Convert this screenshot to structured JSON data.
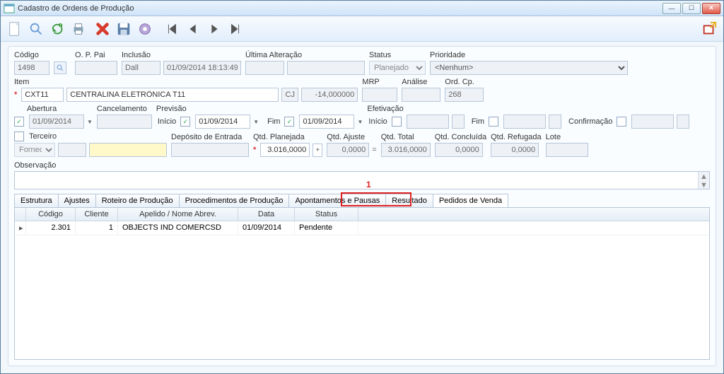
{
  "window": {
    "title": "Cadastro de Ordens de Produção"
  },
  "icons": {
    "app": "app-icon",
    "new": "new-icon",
    "search": "search-icon",
    "refresh": "refresh-icon",
    "print": "print-icon",
    "delete": "delete-icon",
    "save": "save-icon",
    "settings": "gear-icon",
    "first": "first-icon",
    "prev": "prev-icon",
    "next": "next-icon",
    "last": "last-icon",
    "export": "export-icon"
  },
  "header": {
    "codigo": {
      "label": "Código",
      "value": "1498"
    },
    "oppai": {
      "label": "O. P. Pai",
      "value": ""
    },
    "inclusao": {
      "label": "Inclusão",
      "user": "Dall",
      "datetime": "01/09/2014 18:13:49"
    },
    "ultima_alt": {
      "label": "Última Alteração",
      "user": "",
      "datetime": ""
    },
    "status": {
      "label": "Status",
      "value": "Planejado"
    },
    "prioridade": {
      "label": "Prioridade",
      "value": "<Nenhum>"
    }
  },
  "item": {
    "label": "Item",
    "code": "CXT11",
    "desc": "CENTRALINA ELETRÔNICA T11",
    "cj_btn": "CJ",
    "qty": "-14,000000",
    "mrp": {
      "label": "MRP",
      "value": ""
    },
    "analise": {
      "label": "Análise",
      "value": ""
    },
    "ordcp": {
      "label": "Ord. Cp.",
      "value": "268"
    }
  },
  "dates": {
    "abertura": {
      "label": "Abertura",
      "value": "01/09/2014"
    },
    "cancelamento": {
      "label": "Cancelamento",
      "value": ""
    },
    "previsao": {
      "label": "Previsão",
      "inicio_lbl": "Início",
      "inicio": "01/09/2014",
      "fim_lbl": "Fim",
      "fim": "01/09/2014"
    },
    "efetivacao": {
      "label": "Efetivação",
      "inicio_lbl": "Início",
      "inicio": "",
      "fim_lbl": "Fim",
      "fim": "",
      "conf_lbl": "Confirmação",
      "conf": ""
    }
  },
  "terceiro": {
    "label": "Terceiro",
    "fornec_lbl": "Fornec.",
    "fornec_val": "",
    "nome": ""
  },
  "deposito": {
    "label": "Depósito de Entrada",
    "value": ""
  },
  "qtd": {
    "planejada": {
      "label": "Qtd. Planejada",
      "value": "3.016,0000"
    },
    "plus": "+",
    "ajuste": {
      "label": "Qtd. Ajuste",
      "value": "0,0000"
    },
    "eq": "=",
    "total": {
      "label": "Qtd. Total",
      "value": "3.016,0000"
    },
    "concluida": {
      "label": "Qtd. Concluída",
      "value": "0,0000"
    },
    "refugada": {
      "label": "Qtd. Refugada",
      "value": "0,0000"
    },
    "lote": {
      "label": "Lote",
      "value": ""
    }
  },
  "obs": {
    "label": "Observação",
    "value": ""
  },
  "tabs": {
    "items": [
      "Estrutura",
      "Ajustes",
      "Roteiro de Produção",
      "Procedimentos de Produção",
      "Apontamentos e Pausas",
      "Resultado",
      "Pedidos de Venda"
    ],
    "active_index": 6,
    "callout": "1"
  },
  "grid": {
    "columns": [
      "",
      "Código",
      "Cliente",
      "Apelido / Nome Abrev.",
      "Data",
      "Status"
    ],
    "rows": [
      {
        "mark": "▸",
        "codigo": "2.301",
        "cliente": "1",
        "apelido": "OBJECTS IND COMERCSD",
        "data": "01/09/2014",
        "status": "Pendente"
      }
    ]
  }
}
